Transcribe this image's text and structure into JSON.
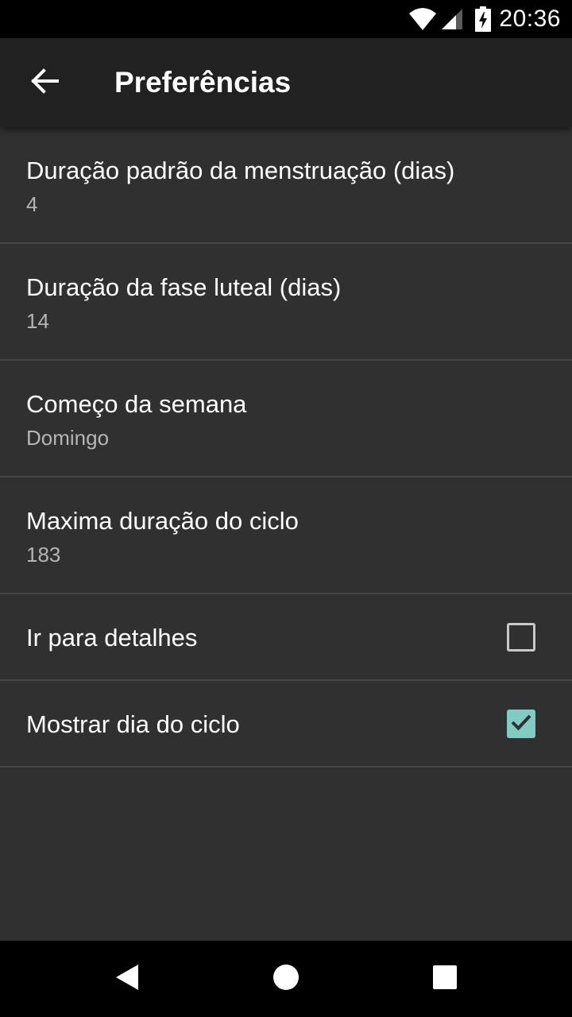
{
  "status_bar": {
    "time": "20:36",
    "icons": [
      "wifi-icon",
      "cell-signal-icon",
      "battery-charging-icon"
    ]
  },
  "app_bar": {
    "title": "Preferências",
    "back_icon": "arrow-left-icon"
  },
  "preferences": [
    {
      "title": "Duração padrão da menstruação (dias)",
      "summary": "4"
    },
    {
      "title": "Duração da fase luteal (dias)",
      "summary": "14"
    },
    {
      "title": "Começo da semana",
      "summary": "Domingo"
    },
    {
      "title": "Maxima duração do ciclo",
      "summary": "183"
    },
    {
      "title": "Ir para detalhes",
      "checked": false
    },
    {
      "title": "Mostrar dia do ciclo",
      "checked": true
    }
  ],
  "nav_bar": {
    "icons": [
      "back-triangle-icon",
      "home-circle-icon",
      "recents-square-icon"
    ]
  },
  "colors": {
    "background": "#303030",
    "app_bar": "#212121",
    "accent": "#80cbc4",
    "divider": "#474747"
  }
}
